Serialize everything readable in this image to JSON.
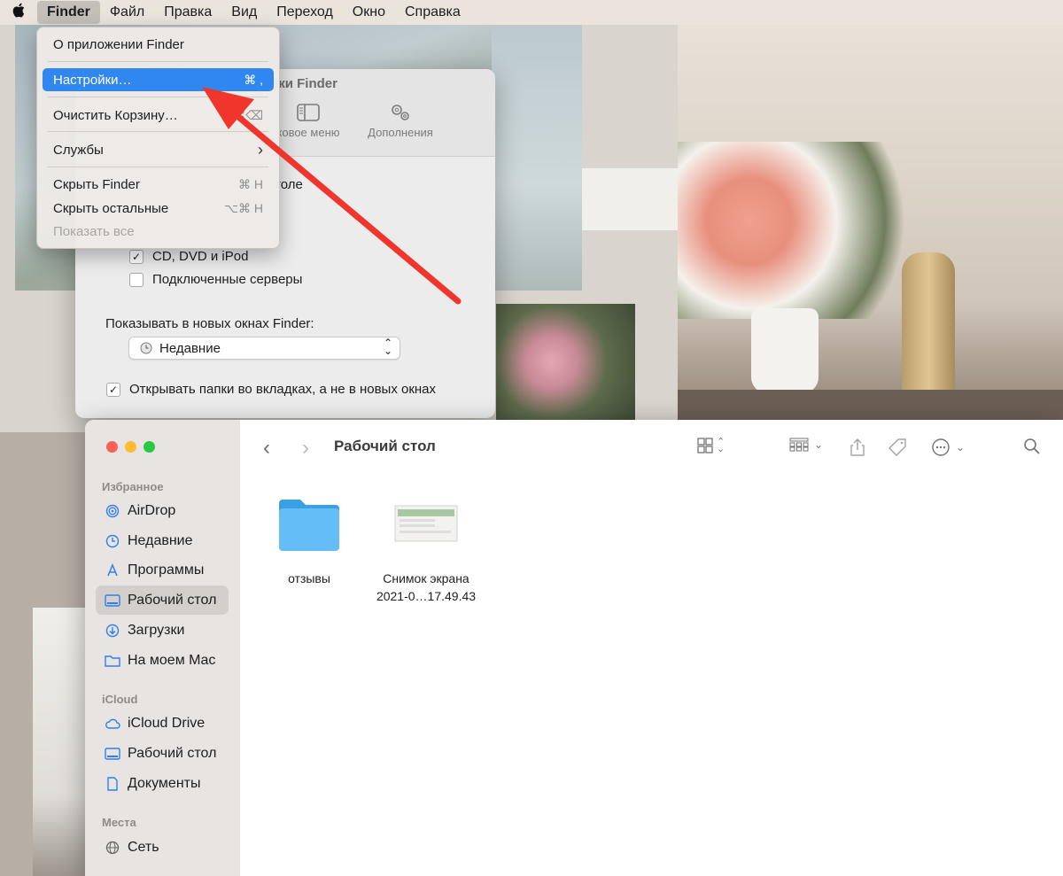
{
  "menubar": {
    "apple_icon": "apple-logo-icon",
    "items": [
      "Finder",
      "Файл",
      "Правка",
      "Вид",
      "Переход",
      "Окно",
      "Справка"
    ]
  },
  "finder_menu": {
    "about": "О приложении Finder",
    "settings": "Настройки…",
    "settings_shortcut": "⌘ ,",
    "empty_trash": "Очистить Корзину…",
    "empty_trash_shortcut": "⌘⌫",
    "services": "Службы",
    "services_arrow": "›",
    "hide_finder": "Скрыть Finder",
    "hide_finder_shortcut": "⌘ H",
    "hide_others": "Скрыть остальные",
    "hide_others_shortcut": "⌥⌘ H",
    "show_all": "Показать все"
  },
  "settings_window": {
    "title": "йки Finder",
    "toolbar": {
      "sidebar_label": "ковое меню",
      "advanced_label": "Дополнения"
    },
    "partial_row": "толе",
    "cd_dvd": "CD, DVD и iPod",
    "cd_dvd_checked": true,
    "servers": "Подключенные серверы",
    "servers_checked": false,
    "new_window_label": "Показывать в новых окнах Finder:",
    "new_window_value": "Недавние",
    "open_tabs": "Открывать папки во вкладках, а не в новых окнах",
    "open_tabs_checked": true
  },
  "finder_window": {
    "title": "Рабочий стол",
    "sidebar": {
      "favorites_header": "Избранное",
      "favorites": [
        "AirDrop",
        "Недавние",
        "Программы",
        "Рабочий стол",
        "Загрузки",
        "На моем Mac"
      ],
      "icloud_header": "iCloud",
      "icloud": [
        "iCloud Drive",
        "Рабочий стол",
        "Документы"
      ],
      "locations_header": "Места",
      "locations": [
        "Сеть"
      ]
    },
    "files": [
      {
        "name": "отзывы",
        "icon": "folder-icon"
      },
      {
        "name_line1": "Снимок экрана",
        "name_line2": "2021-0…17.49.43",
        "icon": "screenshot-thumbnail"
      }
    ]
  },
  "colors": {
    "accent": "#2f87ef",
    "arrow": "#f0352c",
    "traffic_red": "#fe5f57",
    "traffic_yellow": "#febc2e",
    "traffic_green": "#28c840"
  }
}
